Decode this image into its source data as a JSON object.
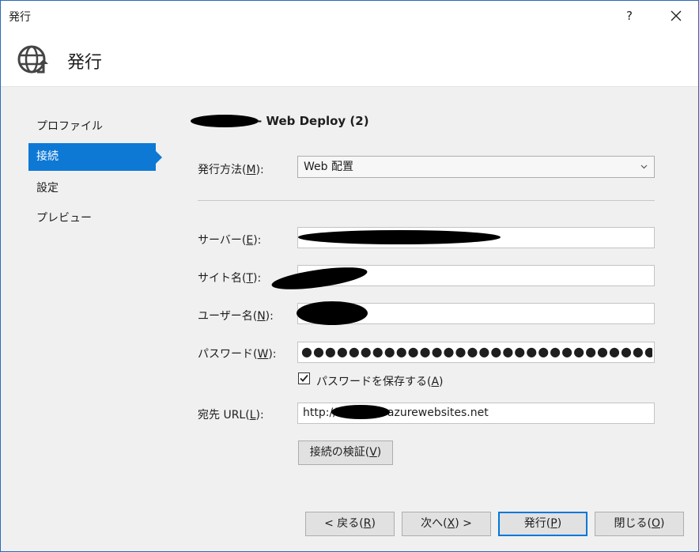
{
  "window": {
    "title": "発行",
    "help_label": "?"
  },
  "header": {
    "title": "発行",
    "icon": "globe-publish-icon"
  },
  "nav": {
    "items": [
      {
        "label": "プロファイル"
      },
      {
        "label": "接続"
      },
      {
        "label": "設定"
      },
      {
        "label": "プレビュー"
      }
    ],
    "active_index": 1
  },
  "profile": {
    "title_suffix": "- Web Deploy (2)"
  },
  "form": {
    "method": {
      "label": "発行方法(",
      "accel": "M",
      "label_end": "):",
      "value": "Web 配置"
    },
    "server": {
      "label": "サーバー(",
      "accel": "E",
      "label_end": "):"
    },
    "site_name": {
      "label": "サイト名(",
      "accel": "T",
      "label_end": "):"
    },
    "user_name": {
      "label": "ユーザー名(",
      "accel": "N",
      "label_end": "):"
    },
    "password": {
      "label": "パスワード(",
      "accel": "W",
      "label_end": "):",
      "mask": "●●●●●●●●●●●●●●●●●●●●●●●●●●●●●●●●●●●●●●●●●●●●●●●●●●"
    },
    "save_password": {
      "label": "パスワードを保存する(",
      "accel": "A",
      "label_end": ")",
      "checked": true
    },
    "dest_url": {
      "label": "宛先 URL(",
      "accel": "L",
      "label_end": "):",
      "value_prefix": "http://",
      "value_suffix": "azurewebsites.net"
    },
    "validate_button": {
      "label": "接続の検証(",
      "accel": "V",
      "label_end": ")"
    }
  },
  "footer": {
    "back": {
      "label": "< 戻る(",
      "accel": "R",
      "label_end": ")"
    },
    "next": {
      "label": "次へ(",
      "accel": "X",
      "label_end": ") >"
    },
    "publish": {
      "label": "発行(",
      "accel": "P",
      "label_end": ")"
    },
    "close": {
      "label": "閉じる(",
      "accel": "O",
      "label_end": ")"
    }
  },
  "colors": {
    "accent": "#0e78d5",
    "background": "#f0f0f0"
  }
}
